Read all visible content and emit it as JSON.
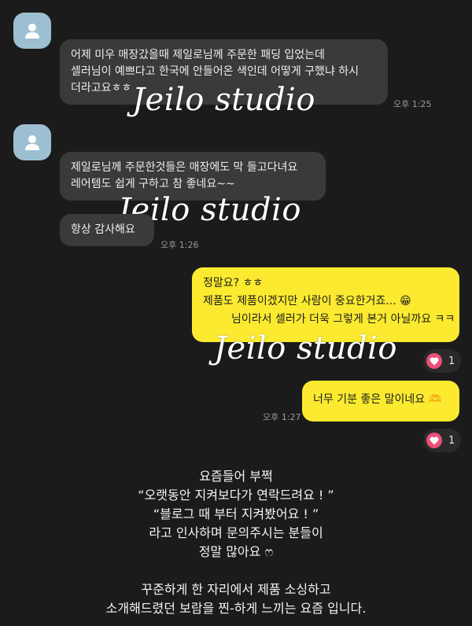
{
  "colors": {
    "background": "#1b1b1b",
    "incoming_bubble": "#3a3a3a",
    "outgoing_bubble": "#fbea2f",
    "avatar": "#9dbfd2",
    "heart": "#e9507a"
  },
  "watermark": "Jeilo studio",
  "messages": {
    "msg1": {
      "lines": [
        "어제 미우 매장갔을때 제일로님께 주문한 패딩 입었는데",
        "셀러님이 예쁘다고 한국에 안들어온 색인데 어떻게 구했냐 하시",
        "더라고요ㅎㅎ"
      ],
      "time": "오후 1:25"
    },
    "msg2": {
      "lines": [
        "제일로님께 주문한것들은 매장에도 막 들고다녀요",
        "레어템도 쉽게 구하고 참 좋네요~~"
      ]
    },
    "msg3": {
      "lines": [
        "항상 감사해요"
      ],
      "time": "오후 1:26"
    },
    "msg4": {
      "lines": [
        "정말요? ㅎㅎ",
        "제품도 제품이겠지만 사람이 중요한거죠... 😁",
        "님이라서 셀러가 더욱 그렇게 본거 아닐까요 ㅋㅋ"
      ],
      "reaction_count": "1"
    },
    "msg5": {
      "lines": [
        "너무 기분 좋은 말이네요 🫶"
      ],
      "time": "오후 1:27",
      "reaction_count": "1"
    }
  },
  "caption": [
    "요즘들어 부쩍",
    "“오랫동안 지켜보다가 연락드려요 ! ”",
    "“블로그 때 부터 지켜봤어요 ! ”",
    "라고 인사하며 문의주시는 분들이",
    "정말 많아요 ෆ",
    "",
    "꾸준하게 한 자리에서 제품 소싱하고",
    "소개해드렸던 보람을 찐-하게 느끼는 요즘 입니다."
  ]
}
